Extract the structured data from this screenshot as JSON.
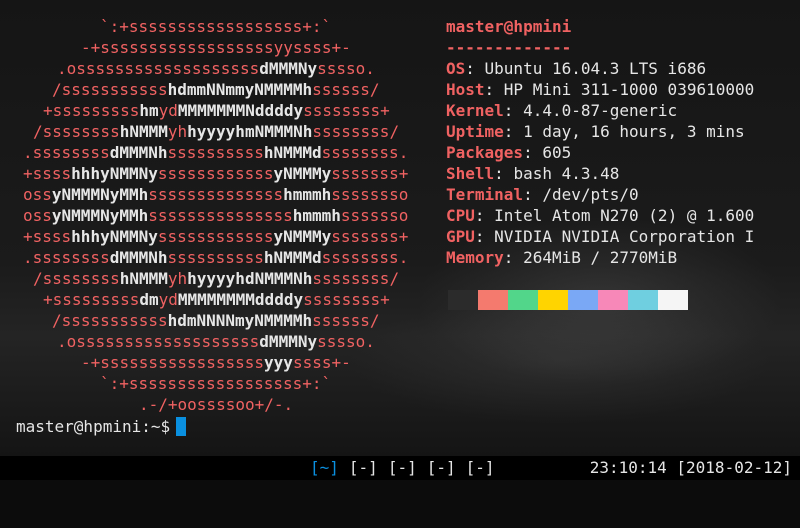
{
  "logo": [
    [
      [
        "r",
        "`:+ssssssssssssssssss+:`"
      ]
    ],
    [
      [
        "r",
        "-+ssssssssssssssssssyyssss+-"
      ]
    ],
    [
      [
        "r",
        ".osssssssssssssssssss"
      ],
      [
        "w",
        "dMMMNy"
      ],
      [
        "r",
        "sssso."
      ]
    ],
    [
      [
        "r",
        "/sssssssssss"
      ],
      [
        "w",
        "hdmmNNmmyNMMMMh"
      ],
      [
        "r",
        "ssssss/"
      ]
    ],
    [
      [
        "r",
        "+sssssssss"
      ],
      [
        "w",
        "hm"
      ],
      [
        "r",
        "yd"
      ],
      [
        "w",
        "MMMMMMMNddddy"
      ],
      [
        "r",
        "ssssssss+"
      ]
    ],
    [
      [
        "r",
        "/ssssssss"
      ],
      [
        "w",
        "hNMMM"
      ],
      [
        "r",
        "yh"
      ],
      [
        "w",
        "hyyyyhmNMMMNh"
      ],
      [
        "r",
        "ssssssss/"
      ]
    ],
    [
      [
        "r",
        ".ssssssss"
      ],
      [
        "w",
        "dMMMNh"
      ],
      [
        "r",
        "ssssssssss"
      ],
      [
        "w",
        "hNMMMd"
      ],
      [
        "r",
        "ssssssss."
      ]
    ],
    [
      [
        "r",
        "+ssss"
      ],
      [
        "w",
        "hhhyNMMNy"
      ],
      [
        "r",
        "ssssssssssss"
      ],
      [
        "w",
        "yNMMMy"
      ],
      [
        "r",
        "sssssss+"
      ]
    ],
    [
      [
        "r",
        "oss"
      ],
      [
        "w",
        "yNMMMNyMMh"
      ],
      [
        "r",
        "ssssssssssssss"
      ],
      [
        "w",
        "hmmmh"
      ],
      [
        "r",
        "ssssssso"
      ]
    ],
    [
      [
        "r",
        "oss"
      ],
      [
        "w",
        "yNMMMNyMMh"
      ],
      [
        "r",
        "sssssssssssssss"
      ],
      [
        "w",
        "hmmmh"
      ],
      [
        "r",
        "sssssso"
      ]
    ],
    [
      [
        "r",
        "+ssss"
      ],
      [
        "w",
        "hhhyNMMNy"
      ],
      [
        "r",
        "ssssssssssss"
      ],
      [
        "w",
        "yNMMMy"
      ],
      [
        "r",
        "sssssss+"
      ]
    ],
    [
      [
        "r",
        ".ssssssss"
      ],
      [
        "w",
        "dMMMNh"
      ],
      [
        "r",
        "ssssssssss"
      ],
      [
        "w",
        "hNMMMd"
      ],
      [
        "r",
        "ssssssss."
      ]
    ],
    [
      [
        "r",
        "/ssssssss"
      ],
      [
        "w",
        "hNMMM"
      ],
      [
        "r",
        "yh"
      ],
      [
        "w",
        "hyyyyhdNMMMNh"
      ],
      [
        "r",
        "ssssssss/"
      ]
    ],
    [
      [
        "r",
        "+sssssssss"
      ],
      [
        "w",
        "dm"
      ],
      [
        "r",
        "yd"
      ],
      [
        "w",
        "MMMMMMMMddddy"
      ],
      [
        "r",
        "ssssssss+"
      ]
    ],
    [
      [
        "r",
        "/sssssssssss"
      ],
      [
        "w",
        "hdmNNNNmyNMMMMh"
      ],
      [
        "r",
        "ssssss/"
      ]
    ],
    [
      [
        "r",
        ".osssssssssssssssssss"
      ],
      [
        "w",
        "dMMMNy"
      ],
      [
        "r",
        "sssso."
      ]
    ],
    [
      [
        "r",
        "-+sssssssssssssssss"
      ],
      [
        "w",
        "yyy"
      ],
      [
        "r",
        "ssss+-"
      ]
    ],
    [
      [
        "r",
        "`:+ssssssssssssssssss+:`"
      ]
    ],
    [
      [
        "r",
        ".-/+oossssoo+/-."
      ]
    ]
  ],
  "info": {
    "user_host": "master@hpmini",
    "separator": "-------------",
    "rows": [
      {
        "key": "OS",
        "value": "Ubuntu 16.04.3 LTS i686"
      },
      {
        "key": "Host",
        "value": "HP Mini 311-1000 039610000"
      },
      {
        "key": "Kernel",
        "value": "4.4.0-87-generic"
      },
      {
        "key": "Uptime",
        "value": "1 day, 16 hours, 3 mins"
      },
      {
        "key": "Packages",
        "value": "605"
      },
      {
        "key": "Shell",
        "value": "bash 4.3.48"
      },
      {
        "key": "Terminal",
        "value": "/dev/pts/0"
      },
      {
        "key": "CPU",
        "value": "Intel Atom N270 (2) @ 1.600"
      },
      {
        "key": "GPU",
        "value": "NVIDIA NVIDIA Corporation I"
      },
      {
        "key": "Memory",
        "value": "264MiB / 2770MiB"
      }
    ],
    "colors": [
      "#2b2b2b",
      "#f47a6e",
      "#52d68a",
      "#ffd400",
      "#7aa8f5",
      "#f788b8",
      "#6fcfe0",
      "#f5f5f5"
    ]
  },
  "prompt": "master@hpmini:~$",
  "statusbar": {
    "tabs": [
      "[~]",
      "[-]",
      "[-]",
      "[-]",
      "[-]"
    ],
    "active_index": 0,
    "clock": "23:10:14 [2018-02-12]"
  }
}
